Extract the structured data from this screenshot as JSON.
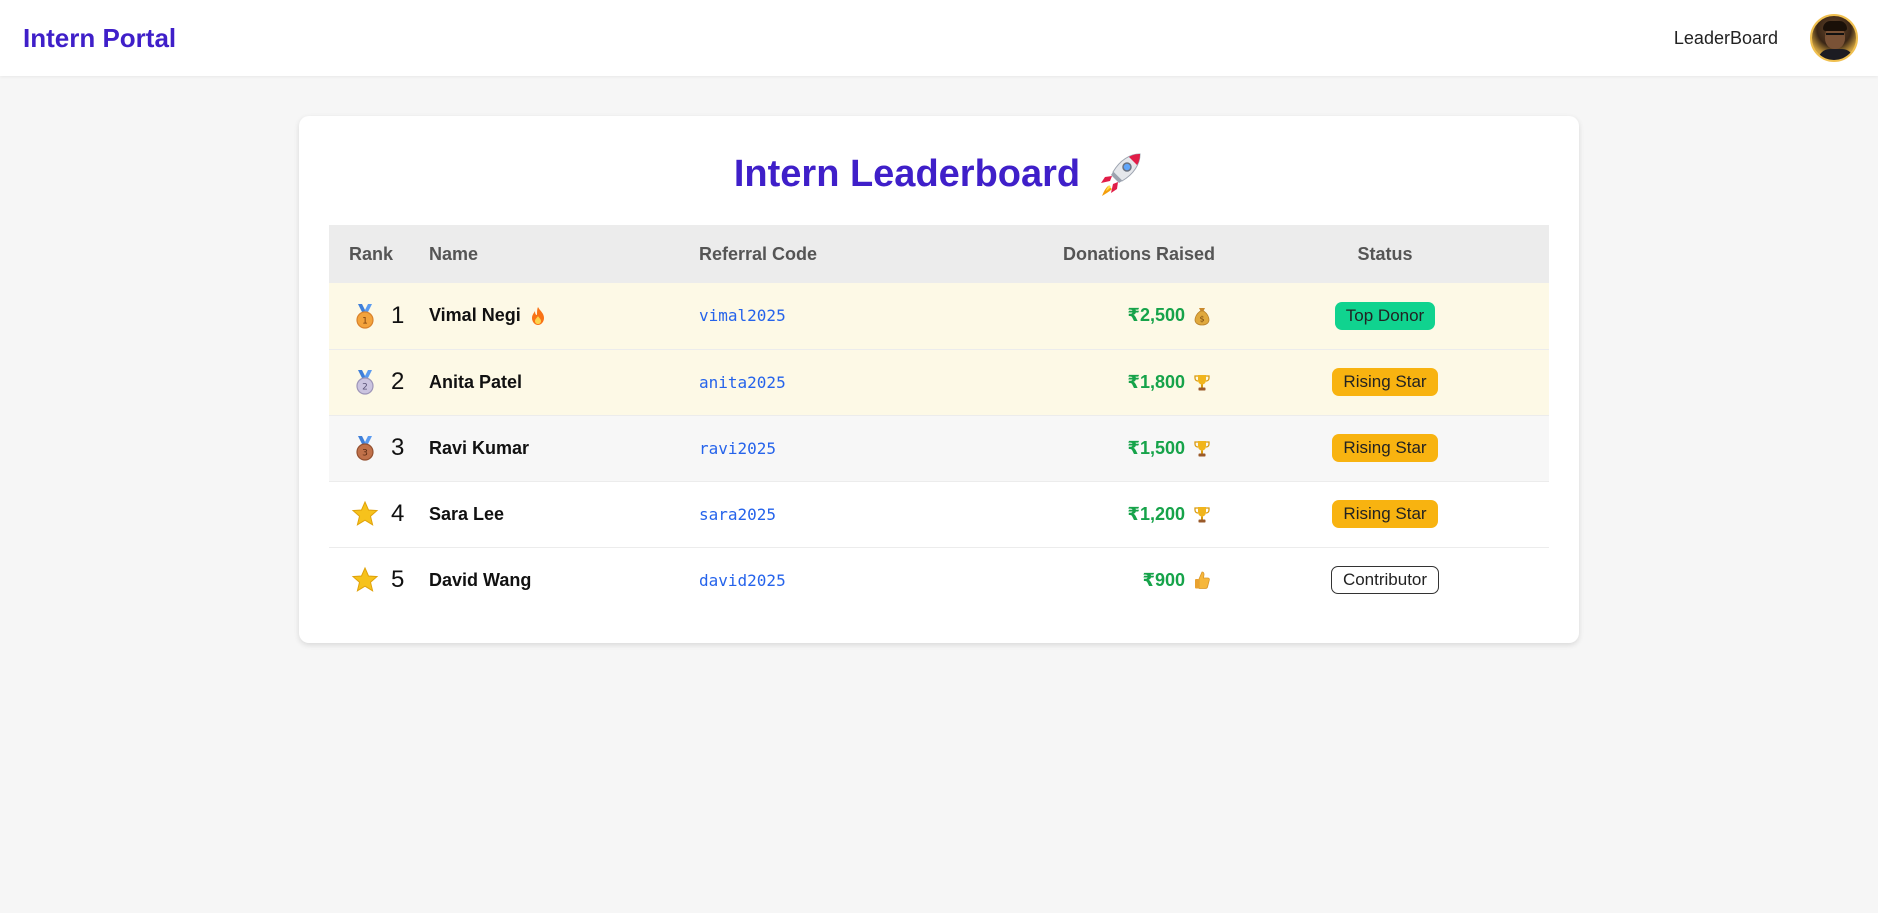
{
  "navbar": {
    "brand": "Intern Portal",
    "link": "LeaderBoard"
  },
  "page": {
    "title": "Intern Leaderboard"
  },
  "table": {
    "headers": {
      "rank": "Rank",
      "name": "Name",
      "code": "Referral Code",
      "donations": "Donations Raised",
      "status": "Status"
    },
    "rows": [
      {
        "rank": "1",
        "rank_icon": "gold-medal-icon",
        "name": "Vimal Negi",
        "name_icon": "fire-icon",
        "code": "vimal2025",
        "donations": "₹2,500",
        "donation_icon": "money-bag-icon",
        "status": "Top Donor",
        "status_color": "#10d38f"
      },
      {
        "rank": "2",
        "rank_icon": "silver-medal-icon",
        "name": "Anita Patel",
        "code": "anita2025",
        "donations": "₹1,800",
        "donation_icon": "trophy-icon",
        "status": "Rising Star",
        "status_color": "#f8b310"
      },
      {
        "rank": "3",
        "rank_icon": "bronze-medal-icon",
        "name": "Ravi Kumar",
        "code": "ravi2025",
        "donations": "₹1,500",
        "donation_icon": "trophy-icon",
        "status": "Rising Star",
        "status_color": "#f8b310"
      },
      {
        "rank": "4",
        "rank_icon": "star-icon",
        "name": "Sara Lee",
        "code": "sara2025",
        "donations": "₹1,200",
        "donation_icon": "trophy-icon",
        "status": "Rising Star",
        "status_color": "#f8b310"
      },
      {
        "rank": "5",
        "rank_icon": "star-icon",
        "name": "David Wang",
        "code": "david2025",
        "donations": "₹900",
        "donation_icon": "thumbs-up-icon",
        "status": "Contributor",
        "status_color": "#ffffff"
      }
    ]
  },
  "colors": {
    "brand": "#3f1fc9",
    "amount": "#16a34a",
    "code": "#2563eb",
    "background": "#f6f6f6"
  }
}
